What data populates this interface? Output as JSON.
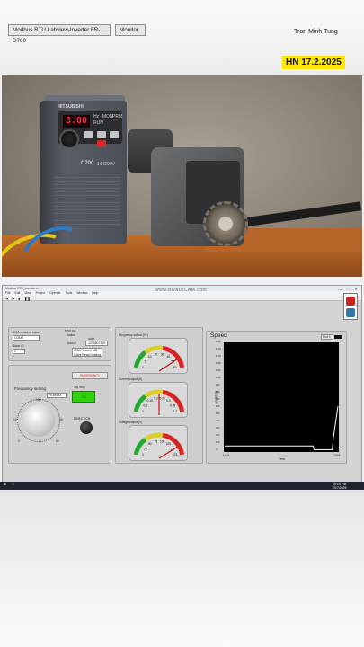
{
  "overlay": {
    "date_badge": "HN 17.2.2025"
  },
  "photo": {
    "inverter_display": "3.00",
    "inverter_brand": "MITSUBISHI",
    "inverter_model": "D700",
    "inverter_voltage": "1ΦI200V",
    "inverter_labels": [
      "Hz",
      "MON",
      "PRM",
      "RUN"
    ]
  },
  "window": {
    "title": "Modbus RTU_Inverter.vi",
    "menu": [
      "File",
      "Edit",
      "View",
      "Project",
      "Operate",
      "Tools",
      "Window",
      "Help"
    ],
    "watermark": "www.BANDICAM.com",
    "controls": [
      "—",
      "□",
      "✕"
    ]
  },
  "tabs": {
    "title": "Modbus RTU Labview-Inverter FR-D700",
    "monitor": "Monitor"
  },
  "author": "Tran Minh Tung",
  "connection": {
    "resource_label": "VISA resource name",
    "resource_value": "COM3",
    "slave_label": "Slave ID",
    "slave_value": "1",
    "error_label": "error out",
    "status_label": "status",
    "code_label": "code",
    "code_value": "-1073807339",
    "source_label": "source",
    "source_value": "VISA Read in MB Slave Read Holding"
  },
  "frequency": {
    "setting_label": "Frequency setting",
    "value": "75.89123",
    "ticks": [
      "0",
      "5",
      "10",
      "15",
      "20",
      "25",
      "30",
      "35",
      "40",
      "45",
      "50"
    ]
  },
  "controls_panel": {
    "emergency_label": "EMERGENCY",
    "run_label": "Tay Stop",
    "led_label": "ON",
    "direction_label": "DIRECTION"
  },
  "gauges": [
    {
      "label": "Frequency output (Hz)",
      "ticks": [
        "0",
        "5",
        "10",
        "20",
        "30",
        "40",
        "50",
        "60"
      ],
      "value": 51
    },
    {
      "label": "Current output (A)",
      "ticks": [
        "0",
        "0.1",
        "0.15",
        "0.2",
        "0.25",
        "0.3",
        "0.35",
        "0.4"
      ],
      "value": 0.2
    },
    {
      "label": "Voltage output (V)",
      "ticks": [
        "0",
        "25",
        "50",
        "75",
        "100",
        "125",
        "150",
        "175"
      ],
      "value": 150
    }
  ],
  "speed_chart": {
    "title": "Speed",
    "legend": "Plot 0",
    "ylabel": "Amplitude",
    "xlabel": "Time",
    "x_start": "5403",
    "x_end": "7028",
    "yticks": [
      "0",
      "100",
      "200",
      "300",
      "400",
      "500",
      "600",
      "700",
      "800",
      "900",
      "1000",
      "1100",
      "1200",
      "1300",
      "1400",
      "1500"
    ],
    "color": "#ffffff",
    "chart_data": {
      "type": "line",
      "x": [
        0,
        0.78,
        0.79,
        0.95,
        0.96,
        1.0
      ],
      "values": [
        60,
        60,
        8,
        8,
        180,
        620
      ]
    }
  },
  "taskbar": {
    "time": "10:13 PM",
    "date": "2/17/2025"
  },
  "colors": {
    "lv_bg": "#d4d4d4",
    "led_on": "#2fd20b",
    "gauge_red": "#d82323",
    "gauge_green": "#22a833"
  }
}
